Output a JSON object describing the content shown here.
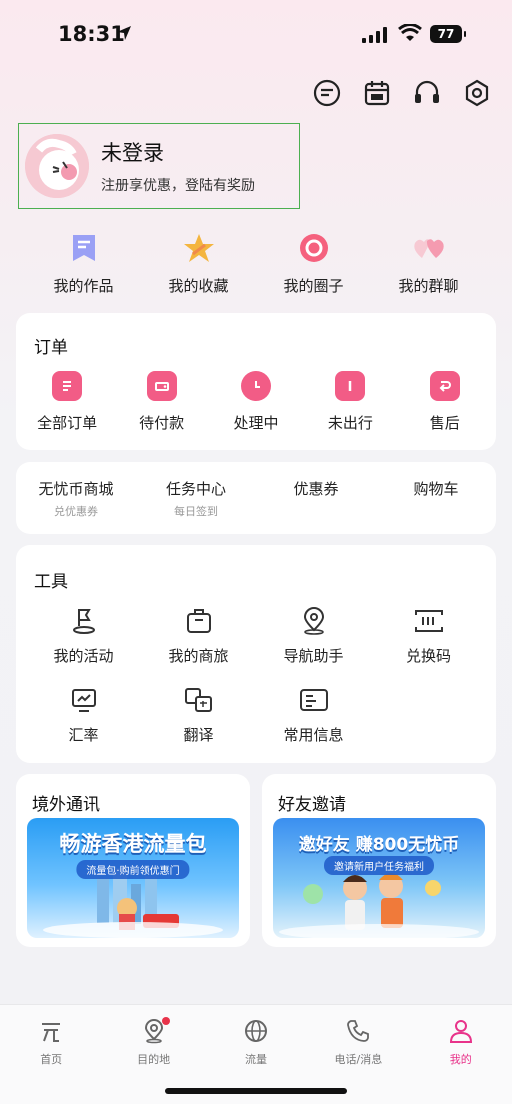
{
  "status": {
    "time": "18:31",
    "battery": "77"
  },
  "login": {
    "title": "未登录",
    "subtitle": "注册享优惠，登陆有奖励"
  },
  "quick": [
    {
      "label": "我的作品",
      "icon": "bookmark-icon"
    },
    {
      "label": "我的收藏",
      "icon": "star-icon"
    },
    {
      "label": "我的圈子",
      "icon": "circle-icon"
    },
    {
      "label": "我的群聊",
      "icon": "hearts-icon"
    }
  ],
  "orders": {
    "title": "订单",
    "items": [
      {
        "label": "全部订单",
        "icon": "document-icon"
      },
      {
        "label": "待付款",
        "icon": "wallet-icon"
      },
      {
        "label": "处理中",
        "icon": "clock-icon"
      },
      {
        "label": "未出行",
        "icon": "ticket-icon"
      },
      {
        "label": "售后",
        "icon": "return-icon"
      }
    ]
  },
  "mall": [
    {
      "label": "无忧币商城",
      "sub": "兑优惠券"
    },
    {
      "label": "任务中心",
      "sub": "每日签到"
    },
    {
      "label": "优惠券",
      "sub": ""
    },
    {
      "label": "购物车",
      "sub": ""
    }
  ],
  "tools": {
    "title": "工具",
    "items": [
      {
        "label": "我的活动",
        "icon": "flag-icon"
      },
      {
        "label": "我的商旅",
        "icon": "briefcase-icon"
      },
      {
        "label": "导航助手",
        "icon": "location-pin-icon"
      },
      {
        "label": "兑换码",
        "icon": "barcode-icon"
      },
      {
        "label": "汇率",
        "icon": "exchange-chart-icon"
      },
      {
        "label": "翻译",
        "icon": "translate-icon"
      },
      {
        "label": "常用信息",
        "icon": "id-card-icon"
      }
    ]
  },
  "promo_left": {
    "title": "境外通讯",
    "banner_title": "畅游香港流量包",
    "banner_sub": "流量包·购前领优惠门"
  },
  "promo_right": {
    "title": "好友邀请",
    "banner_title": "邀好友 赚800无忧币",
    "banner_sub": "邀请新用户任务福利"
  },
  "tabs": [
    {
      "label": "首页",
      "icon": "home-icon"
    },
    {
      "label": "目的地",
      "icon": "map-pin-icon"
    },
    {
      "label": "流量",
      "icon": "globe-icon"
    },
    {
      "label": "电话/消息",
      "icon": "phone-icon"
    },
    {
      "label": "我的",
      "icon": "user-icon"
    }
  ],
  "colors": {
    "accent": "#e8338a",
    "pink_icon": "#f25c86",
    "login_border": "#4caf50"
  }
}
